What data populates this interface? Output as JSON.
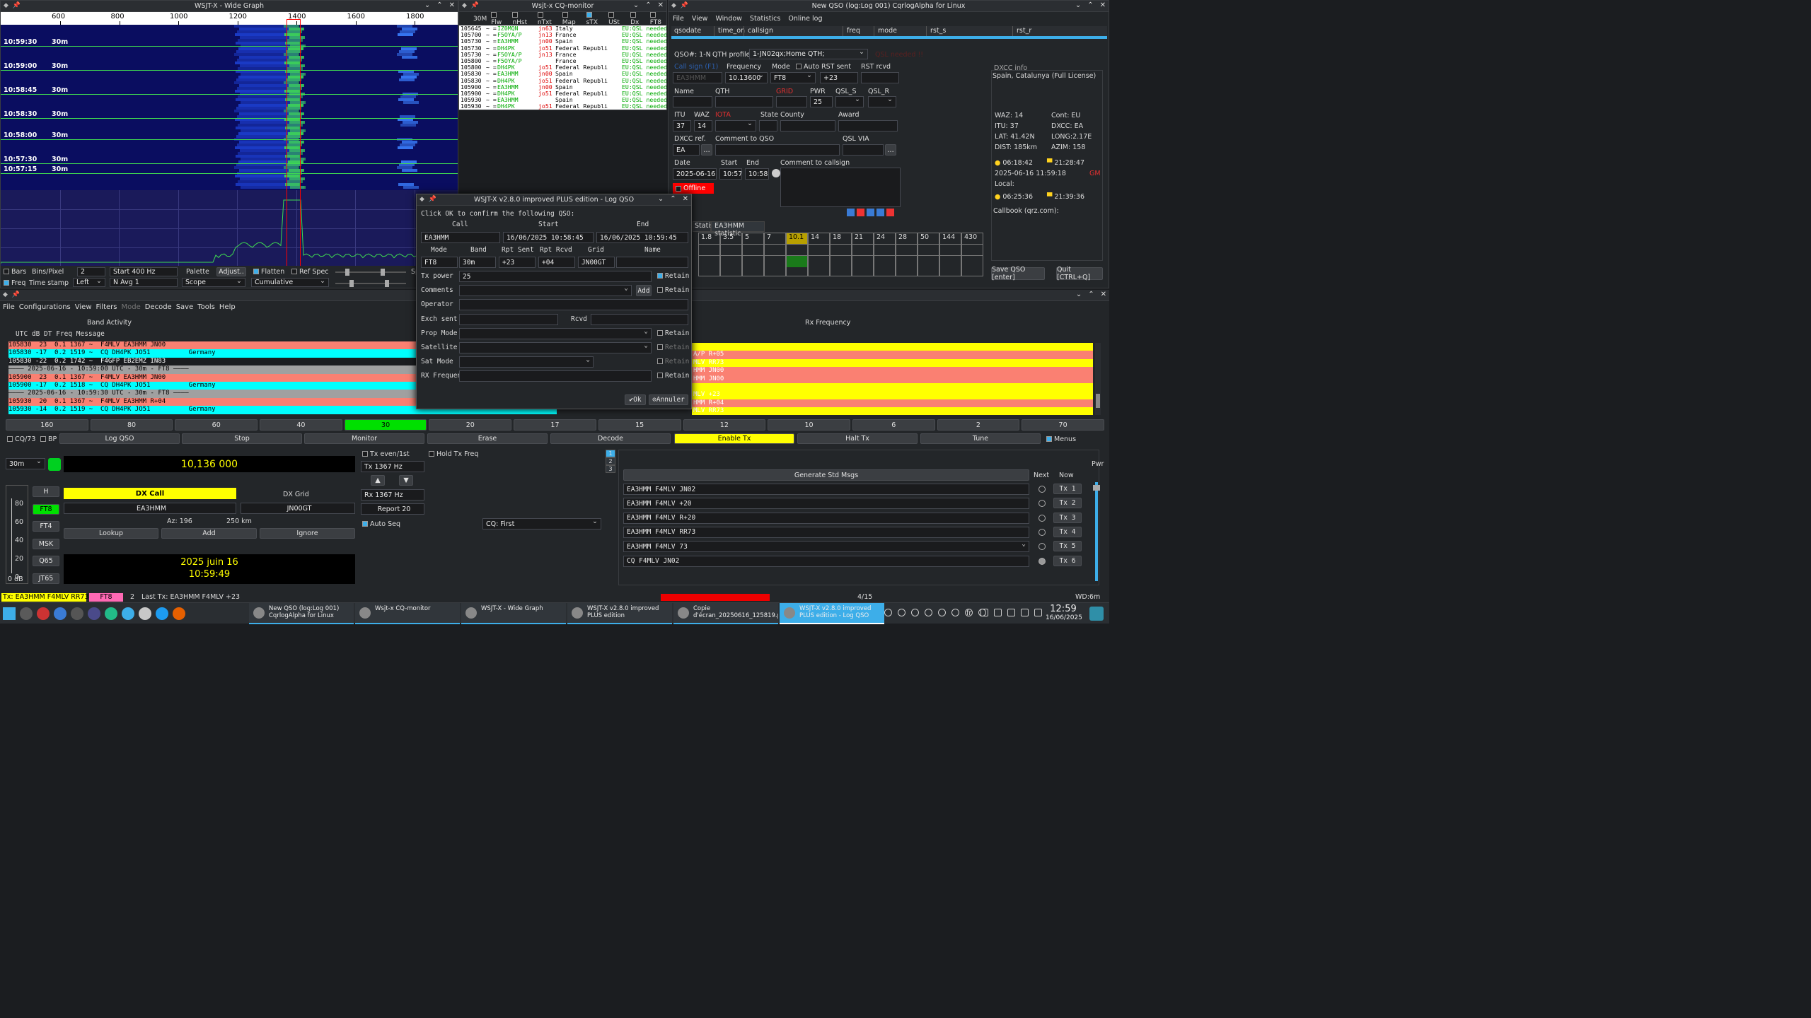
{
  "wide_graph": {
    "title": "WSJT-X - Wide Graph",
    "freq_ticks": [
      "600",
      "800",
      "1000",
      "1200",
      "1400",
      "1600",
      "1800"
    ],
    "times": [
      {
        "t": "10:59:30",
        "b": "30m"
      },
      {
        "t": "10:59:00",
        "b": "30m"
      },
      {
        "t": "10:58:45",
        "b": "30m"
      },
      {
        "t": "10:58:30",
        "b": "30m"
      },
      {
        "t": "10:58:00",
        "b": "30m"
      },
      {
        "t": "10:57:30",
        "b": "30m"
      },
      {
        "t": "10:57:15",
        "b": "30m"
      }
    ],
    "ctrl": {
      "bars": "Bars",
      "bins_label": "Bins/Pixel",
      "bins": "2",
      "start": "Start 400 Hz",
      "palette": "Palette",
      "adjust": "Adjust..",
      "flatten": "Flatten",
      "refspec": "Ref Spec",
      "sp": "Sp",
      "freq": "Freq",
      "timestamp": "Time stamp",
      "left": "Left",
      "navg": "N Avg 1",
      "scope": "Scope",
      "cumulative": "Cumulative"
    }
  },
  "cq_monitor": {
    "title": "Wsjt-x CQ-monitor",
    "filters": [
      "30M",
      "Flw",
      "nHst",
      "nTxt",
      "Map",
      "sTX",
      "USt",
      "Dx",
      "FT8"
    ],
    "rows": [
      {
        "t": "105645",
        "c": "IZ0MQN",
        "g": "jn63",
        "country": "Italy",
        "s": "EU:QSL needed"
      },
      {
        "t": "105700",
        "c": "F5OYA/P",
        "g": "jn13",
        "country": "France",
        "s": "EU:QSL needed"
      },
      {
        "t": "105730",
        "c": "EA3HMM",
        "g": "jn00",
        "country": "Spain",
        "s": "EU:QSL needed"
      },
      {
        "t": "105730",
        "c": "DH4PK",
        "g": "jo51",
        "country": "Federal Republi",
        "s": "EU:QSL needed"
      },
      {
        "t": "105730",
        "c": "F5OYA/P",
        "g": "jn13",
        "country": "France",
        "s": "EU:QSL needed"
      },
      {
        "t": "105800",
        "c": "F5OYA/P",
        "g": "",
        "country": "France",
        "s": "EU:QSL needed"
      },
      {
        "t": "105800",
        "c": "DH4PK",
        "g": "jo51",
        "country": "Federal Republi",
        "s": "EU:QSL needed"
      },
      {
        "t": "105830",
        "c": "EA3HMM",
        "g": "jn00",
        "country": "Spain",
        "s": "EU:QSL needed"
      },
      {
        "t": "105830",
        "c": "DH4PK",
        "g": "jo51",
        "country": "Federal Republi",
        "s": "EU:QSL needed"
      },
      {
        "t": "105900",
        "c": "EA3HMM",
        "g": "jn00",
        "country": "Spain",
        "s": "EU:QSL needed"
      },
      {
        "t": "105900",
        "c": "DH4PK",
        "g": "jo51",
        "country": "Federal Republi",
        "s": "EU:QSL needed"
      },
      {
        "t": "105930",
        "c": "EA3HMM",
        "g": "",
        "country": "Spain",
        "s": "EU:QSL needed"
      },
      {
        "t": "105930",
        "c": "DH4PK",
        "g": "jo51",
        "country": "Federal Republi",
        "s": "EU:QSL needed"
      }
    ]
  },
  "cqrlog": {
    "title": "New QSO (log:Log 001) CqrlogAlpha for Linux",
    "menu": [
      "File",
      "View",
      "Window",
      "Statistics",
      "Online log"
    ],
    "cols": [
      "qsodate",
      "time_on",
      "callsign",
      "freq",
      "mode",
      "rst_s",
      "rst_r"
    ],
    "qso_no": "QSO#: 1-N",
    "qth_profile_lbl": "QTH profile:",
    "qth_profile": "1-JN02qx;Home QTH;",
    "qsl_needed": "QSL needed !!",
    "call_lbl": "Call sign (F1)",
    "freq_lbl": "Frequency",
    "mode_lbl": "Mode",
    "auto": "Auto",
    "rst_sent_lbl": "RST sent",
    "rst_rcvd_lbl": "RST rcvd",
    "call": "EA3HMM",
    "freq": "10.13600",
    "mode": "FT8",
    "rst_sent": "+23",
    "name_lbl": "Name",
    "qth_lbl": "QTH",
    "grid_lbl": "GRID",
    "pwr_lbl": "PWR",
    "qsls_lbl": "QSL_S",
    "qslr_lbl": "QSL_R",
    "pwr": "25",
    "itu_lbl": "ITU",
    "waz_lbl": "WAZ",
    "iota_lbl": "IOTA",
    "state_lbl": "State",
    "county_lbl": "County",
    "award_lbl": "Award",
    "itu": "37",
    "waz": "14",
    "dxcc_lbl": "DXCC ref.",
    "comment_lbl": "Comment to QSO",
    "qslvia_lbl": "QSL VIA",
    "dxcc": "EA",
    "date_lbl": "Date",
    "start_lbl": "Start",
    "end_lbl": "End",
    "comment_call_lbl": "Comment to callsign",
    "date": "2025-06-16",
    "start": "10:57",
    "end": "10:58",
    "offline": "Offline",
    "tabs": [
      "Statistic",
      "EA3HMM statistic"
    ],
    "bands": [
      "1.8",
      "3.5",
      "5",
      "7",
      "10.1",
      "14",
      "18",
      "21",
      "24",
      "28",
      "50",
      "144",
      "430"
    ],
    "dxcc_info_lbl": "DXCC info",
    "dxcc_info": "Spain, Catalunya (Full License)",
    "waz_i": "WAZ:  14",
    "cont": "Cont:  EU",
    "itu_i": "ITU:   37",
    "dxcc_i": "DXCC: EA",
    "lat": "LAT:   41.42N",
    "long": "LONG:2.17E",
    "dist": "DIST:  185km",
    "azim": "AZIM:  158",
    "sunrise1": "06:18:42",
    "sunset1": "21:28:47",
    "dt": "2025-06-16  11:59:18",
    "gm": "GM",
    "local": "Local:",
    "sunrise2": "06:25:36",
    "sunset2": "21:39:36",
    "callbook": "Callbook (qrz.com):",
    "save": "Save QSO [enter]",
    "quit": "Quit [CTRL+Q]"
  },
  "log_qso": {
    "title": "WSJT-X v2.8.0 improved PLUS edition - Log QSO",
    "prompt": "Click OK to confirm the following QSO:",
    "call_lbl": "Call",
    "start_lbl": "Start",
    "end_lbl": "End",
    "call": "EA3HMM",
    "start": "16/06/2025 10:58:45",
    "end": "16/06/2025 10:59:45",
    "mode_lbl": "Mode",
    "band_lbl": "Band",
    "rs_lbl": "Rpt Sent",
    "rr_lbl": "Rpt Rcvd",
    "grid_lbl": "Grid",
    "name_lbl": "Name",
    "mode": "FT8",
    "band": "30m",
    "rs": "+23",
    "rr": "+04",
    "grid": "JN00GT",
    "txpower_lbl": "Tx power",
    "txpower": "25",
    "retain": "Retain",
    "comments_lbl": "Comments",
    "add": "Add",
    "operator_lbl": "Operator",
    "exch_lbl": "Exch sent",
    "rcvd_lbl": "Rcvd",
    "prop_lbl": "Prop Mode",
    "sat_lbl": "Satellite",
    "satmode_lbl": "Sat Mode",
    "rxf_lbl": "RX Frequency",
    "ok": "Ok",
    "cancel": "Annuler"
  },
  "main": {
    "menu": [
      "File",
      "Configurations",
      "View",
      "Filters",
      "Mode",
      "Decode",
      "Save",
      "Tools",
      "Help"
    ],
    "band_activity": "Band Activity",
    "rx_frequency": "Rx Frequency",
    "hdr": "UTC   dB   DT Freq     Message",
    "lines": [
      {
        "txt": "105830  23  0.1 1367 ~  F4MLV EA3HMM JN00",
        "bg": "#fa8072",
        "fg": "#000"
      },
      {
        "txt": "105830 -17  0.2 1519 ~  CQ DH4PK JO51          Germany",
        "bg": "#00ffff",
        "fg": "#000"
      },
      {
        "txt": "105830 -22  0.2 1742 ~  F4GFP EB2EMZ IN83",
        "bg": "#1b1d20",
        "fg": "#fff"
      },
      {
        "txt": "———— 2025-06-16 - 10:59:00 UTC - 30m - FT8 ————",
        "bg": "#a0a0a0",
        "fg": "#000"
      },
      {
        "txt": "105900  23  0.1 1367 ~  F4MLV EA3HMM JN00",
        "bg": "#fa8072",
        "fg": "#000"
      },
      {
        "txt": "105900 -17  0.2 1518 ~  CQ DH4PK JO51          Germany",
        "bg": "#00ffff",
        "fg": "#000"
      },
      {
        "txt": "———— 2025-06-16 - 10:59:30 UTC - 30m - FT8 ————",
        "bg": "#a0a0a0",
        "fg": "#000"
      },
      {
        "txt": "105930  20  0.1 1367 ~  F4MLV EA3HMM R+04",
        "bg": "#fa8072",
        "fg": "#000"
      },
      {
        "txt": "105930 -14  0.2 1519 ~  CQ DH4PK JO51          Germany",
        "bg": "#00ffff",
        "fg": "#000"
      }
    ],
    "rx_lines": [
      {
        "txt": "",
        "bg": "#ffff00"
      },
      {
        "txt": "A/P R+05",
        "bg": "#fa8072"
      },
      {
        "txt": "MLV RR73",
        "bg": "#ffff00"
      },
      {
        "txt": "HMM JN00",
        "bg": "#fa8072"
      },
      {
        "txt": "HMM JN00",
        "bg": "#fa8072"
      },
      {
        "txt": "",
        "bg": "#ffff00"
      },
      {
        "txt": "MLV +23",
        "bg": "#ffff00"
      },
      {
        "txt": "HMM R+04",
        "bg": "#fa8072"
      },
      {
        "txt": "MLV RR73",
        "bg": "#ffff00"
      }
    ],
    "bands": [
      "160",
      "80",
      "60",
      "40",
      "30",
      "20",
      "17",
      "15",
      "12",
      "10",
      "6",
      "2",
      "70"
    ],
    "active_band": "30",
    "controls": {
      "cq73": "CQ/73",
      "bp": "BP",
      "log": "Log QSO",
      "stop": "Stop",
      "monitor": "Monitor",
      "erase": "Erase",
      "decode": "Decode",
      "enable": "Enable Tx",
      "halt": "Halt Tx",
      "tune": "Tune",
      "menus": "Menus"
    },
    "band_sel": "30m",
    "freq": "10,136 000",
    "modes": [
      "H",
      "FT8",
      "FT4",
      "MSK",
      "Q65",
      "JT65"
    ],
    "active_mode": "FT8",
    "db_scale": [
      "80",
      "60",
      "40",
      "20",
      "0"
    ],
    "db": "0 dB",
    "dx_call_lbl": "DX Call",
    "dx_grid_lbl": "DX Grid",
    "dx_call": "EA3HMM",
    "dx_grid": "JN00GT",
    "az": "Az: 196",
    "dist": "250 km",
    "lookup": "Lookup",
    "add": "Add",
    "ignore": "Ignore",
    "date": "2025 juin 16",
    "time": "10:59:49",
    "tx_even": "Tx even/1st",
    "hold": "Hold Tx Freq",
    "tx": "Tx  1367  Hz",
    "rx": "Rx  1367  Hz",
    "report": "Report 20",
    "autoseq": "Auto Seq",
    "cq": "CQ: First",
    "gen": "Generate Std Msgs",
    "next": "Next",
    "now": "Now",
    "pwr": "Pwr",
    "msgs": [
      {
        "m": "EA3HMM F4MLV JN02",
        "b": "Tx 1"
      },
      {
        "m": "EA3HMM F4MLV +20",
        "b": "Tx 2"
      },
      {
        "m": "EA3HMM F4MLV R+20",
        "b": "Tx 3"
      },
      {
        "m": "EA3HMM F4MLV RR73",
        "b": "Tx 4"
      },
      {
        "m": "EA3HMM F4MLV 73",
        "b": "Tx 5"
      },
      {
        "m": "CQ F4MLV JN02",
        "b": "Tx 6"
      }
    ],
    "tabs": [
      "1",
      "2",
      "3"
    ],
    "status": {
      "tx": "Tx: EA3HMM F4MLV RR73",
      "mode": "FT8",
      "n": "2",
      "last": "Last Tx: EA3HMM F4MLV +23",
      "prog": "4/15",
      "wd": "WD:6m"
    }
  },
  "taskbar": {
    "items": [
      {
        "t1": "New QSO (log:Log 001)",
        "t2": "CqrlogAlpha for Linux"
      },
      {
        "t1": "Wsjt-x CQ-monitor",
        "t2": ""
      },
      {
        "t1": "WSJT-X - Wide Graph",
        "t2": ""
      },
      {
        "t1": "WSJT-X v2.8.0 improved",
        "t2": "PLUS edition"
      },
      {
        "t1": "Copie",
        "t2": "d'écran_20250616_125819.p..."
      },
      {
        "t1": "WSJT-X v2.8.0 improved",
        "t2": "PLUS edition - Log QSO"
      }
    ],
    "lang": "fr",
    "time": "12:59",
    "date": "16/06/2025"
  }
}
